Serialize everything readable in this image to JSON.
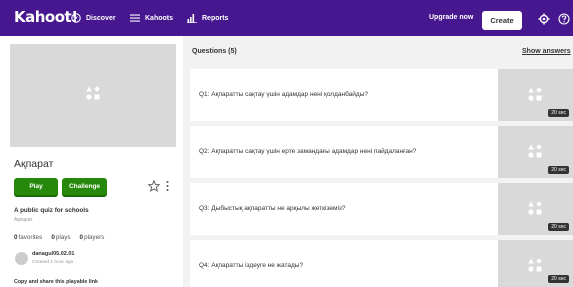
{
  "nav": {
    "logo": "Kahoot!",
    "items": [
      {
        "label": "Discover",
        "icon": "compass-icon"
      },
      {
        "label": "Kahoots",
        "icon": "list-icon"
      },
      {
        "label": "Reports",
        "icon": "bar-chart-icon"
      }
    ],
    "upgrade_label": "Upgrade now",
    "create_label": "Create",
    "settings_icon": "gear-icon",
    "help_icon": "help-icon",
    "brand_color": "#46178f"
  },
  "kahoot": {
    "title": "Ақпарат",
    "play_label": "Play",
    "challenge_label": "Challenge",
    "description": "A public quiz for schools",
    "language": "Ақпарат",
    "favorites": "0",
    "favorites_label": "favorites",
    "plays": "0",
    "plays_label": "plays",
    "players": "0",
    "players_label": "players",
    "author": "danagul05.02.01",
    "created": "Created 1 hour ago",
    "share_text": "Copy and share this playable link",
    "accent_color": "#26890c"
  },
  "questions": {
    "heading": "Questions (5)",
    "show_answers_label": "Show answers",
    "items": [
      {
        "text": "Q1: Ақпаратты сақтау үшін адамдар нені қолданбайды?",
        "time": "20 sec"
      },
      {
        "text": "Q2: Ақпаратты сақтау үшін ерте замандағы адамдар нені пайдаланған?",
        "time": "20 sec"
      },
      {
        "text": "Q3: Дыбыстық ақпаратты не арқылы жеткіземіз?",
        "time": "20 sec"
      },
      {
        "text": "Q4: Ақпаратты іздеуге не жатады?",
        "time": "20 sec"
      }
    ]
  }
}
